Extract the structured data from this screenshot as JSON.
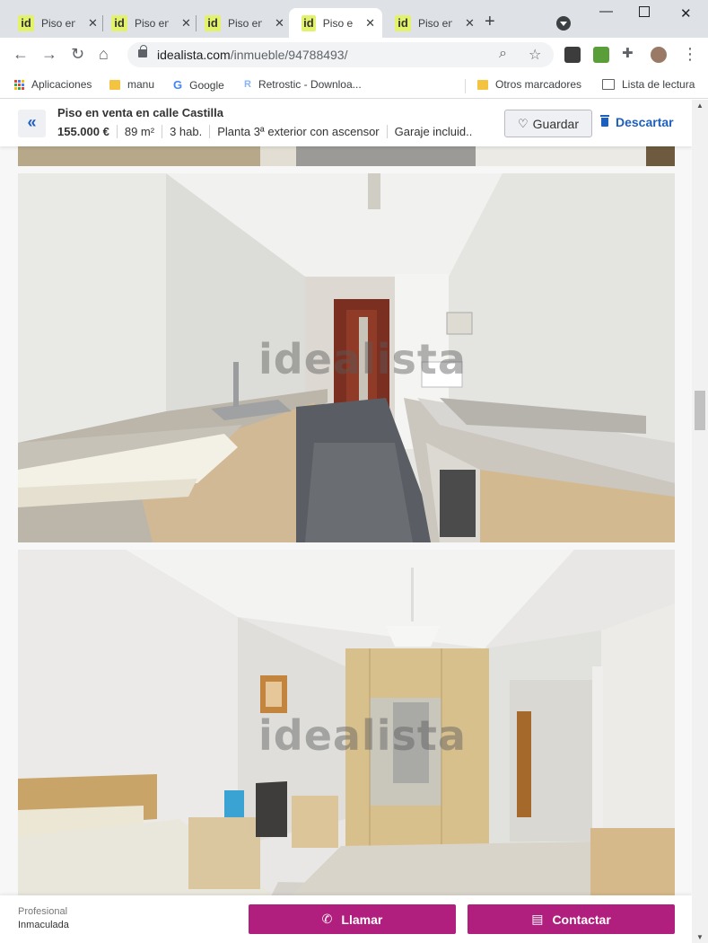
{
  "browser": {
    "tabs": [
      {
        "title": "Piso en",
        "favicon": "id",
        "active": false
      },
      {
        "title": "Piso en",
        "favicon": "id",
        "active": false
      },
      {
        "title": "Piso en",
        "favicon": "id",
        "active": false
      },
      {
        "title": "Piso en",
        "favicon": "id",
        "active": true
      },
      {
        "title": "Piso en",
        "favicon": "id",
        "active": false
      }
    ],
    "url_host": "idealista.com",
    "url_path": "/inmueble/94788493/",
    "bookmarks": [
      "Aplicaciones",
      "manu",
      "Google",
      "Retrostic - Downloa...",
      "Otros marcadores",
      "Lista de lectura"
    ]
  },
  "listing": {
    "title": "Piso en venta en calle Castilla",
    "price": "155.000 €",
    "area": "89 m²",
    "rooms": "3 hab.",
    "floor": "Planta 3ª exterior con ascensor",
    "garage": "Garaje incluid..."
  },
  "actions": {
    "save_label": "Guardar",
    "discard_label": "Descartar"
  },
  "photos": {
    "watermark": "idealista"
  },
  "footer": {
    "advertiser_type": "Profesional",
    "advertiser_name": "Inmaculada",
    "call_label": "Llamar",
    "contact_label": "Contactar"
  },
  "colors": {
    "accent": "#1d5fbf",
    "cta": "#b01f7e",
    "favicon": "#e2f26b"
  }
}
